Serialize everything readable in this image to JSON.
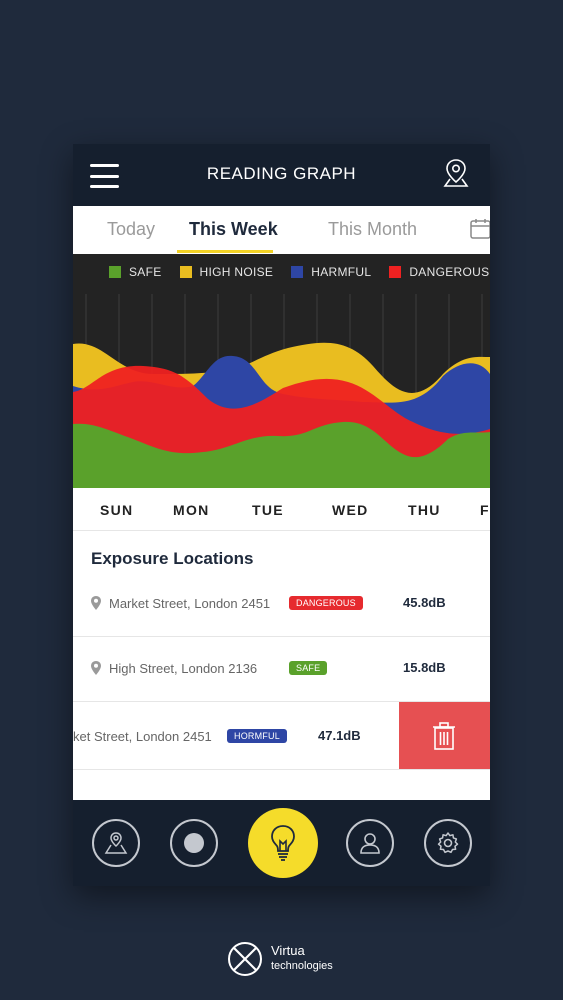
{
  "header": {
    "title": "READING GRAPH"
  },
  "tabs": {
    "today": "Today",
    "week": "This Week",
    "month": "This Month"
  },
  "legend": [
    {
      "label": "SAFE",
      "color": "#5aa12b"
    },
    {
      "label": "HIGH NOISE",
      "color": "#e9bd20"
    },
    {
      "label": "HARMFUL",
      "color": "#2e46a5"
    },
    {
      "label": "DANGEROUS",
      "color": "#ef2121"
    }
  ],
  "days": [
    "SUN",
    "MON",
    "TUE",
    "WED",
    "THU",
    "F"
  ],
  "exposure": {
    "title": "Exposure Locations",
    "rows": [
      {
        "address": "Market Street, London 2451",
        "status": "DANGEROUS",
        "status_color": "#e62a2e",
        "db": "45.8dB"
      },
      {
        "address": "High Street, London 2136",
        "status": "SAFE",
        "status_color": "#5aa12b",
        "db": "15.8dB"
      },
      {
        "address": "ket Street, London 2451",
        "status": "HORMFUL",
        "status_color": "#2e46a5",
        "db": "47.1dB"
      }
    ]
  },
  "icons": {
    "menu": "menu-icon",
    "location": "location-pin-icon",
    "calendar": "calendar-icon",
    "trash": "trash-icon",
    "map": "map-icon",
    "record": "record-icon",
    "bulb": "lightbulb-icon",
    "profile": "profile-icon",
    "settings": "gear-icon"
  },
  "colors": {
    "header_bg": "#151f2e",
    "page_bg": "#1f2a3c",
    "accent": "#f5dc2a",
    "delete": "#e65052",
    "chart_bg": "#232323"
  },
  "brand": {
    "name": "Virtua",
    "sub": "technologies"
  }
}
